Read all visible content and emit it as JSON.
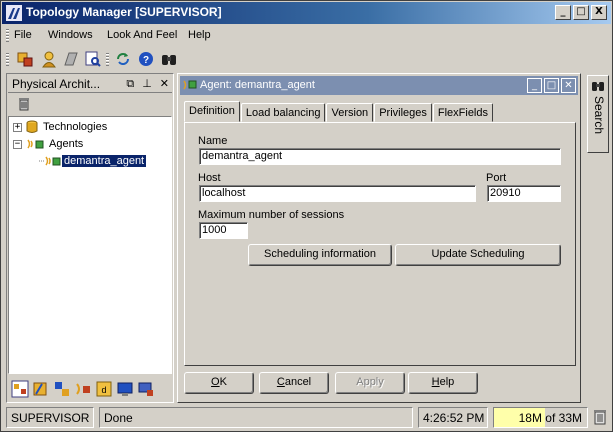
{
  "window": {
    "title": "Topology Manager [SUPERVISOR]",
    "min": "_",
    "max": "□",
    "close": "X"
  },
  "menu": {
    "items": [
      "File",
      "Windows",
      "Look And Feel",
      "Help"
    ]
  },
  "physical": {
    "title": "Physical Archit...",
    "tree": [
      {
        "label": "Technologies",
        "expander": "+"
      },
      {
        "label": "Agents",
        "expander": "−"
      },
      {
        "label": "demantra_agent"
      }
    ]
  },
  "agent": {
    "title": "Agent: demantra_agent",
    "tabs": [
      "Definition",
      "Load balancing",
      "Version",
      "Privileges",
      "FlexFields"
    ],
    "name_label": "Name",
    "name_value": "demantra_agent",
    "host_label": "Host",
    "host_value": "localhost",
    "port_label": "Port",
    "port_value": "20910",
    "max_label": "Maximum number of sessions",
    "max_value": "1000",
    "sched_info": "Scheduling information",
    "update_sched": "Update Scheduling",
    "ok_first": "O",
    "ok_rest": "K",
    "cancel_first": "C",
    "cancel_rest": "ancel",
    "apply": "Apply",
    "help_first": "H",
    "help_rest": "elp"
  },
  "search": {
    "label": "Search"
  },
  "status": {
    "user": "SUPERVISOR",
    "message": "Done",
    "time": "4:26:52 PM",
    "memory": "18M of 33M",
    "memory_used_fraction": 0.55
  }
}
